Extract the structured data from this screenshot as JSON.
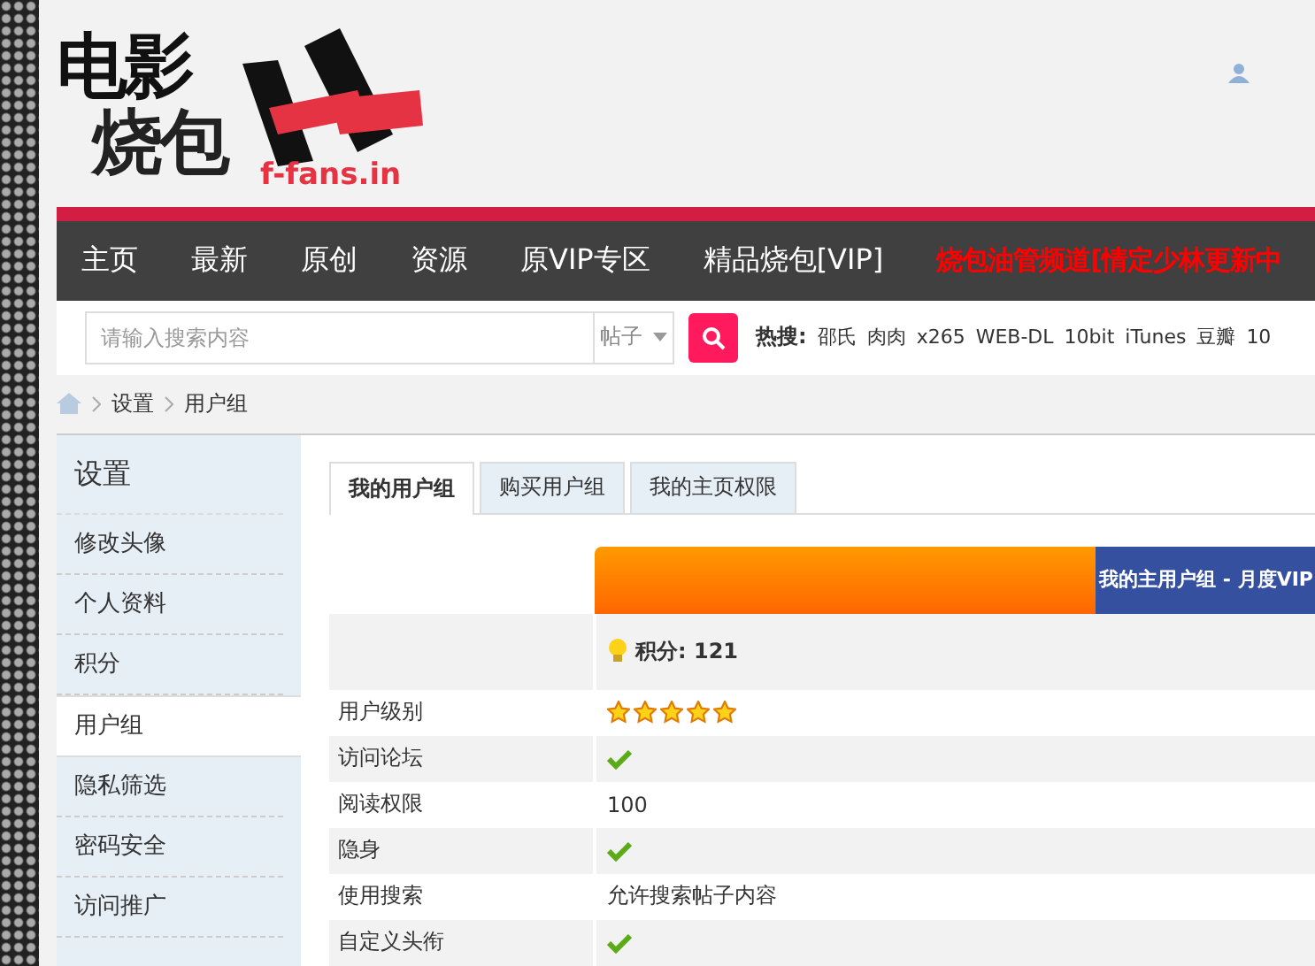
{
  "logo": {
    "line_1": "电影",
    "line_2": "烧包",
    "domain": "f-fans.in"
  },
  "nav": [
    {
      "label": "主页",
      "kind": "normal"
    },
    {
      "label": "最新",
      "kind": "normal"
    },
    {
      "label": "原创",
      "kind": "normal"
    },
    {
      "label": "资源",
      "kind": "normal"
    },
    {
      "label": "原VIP专区",
      "kind": "normal"
    },
    {
      "label": "精品烧包[VIP]",
      "kind": "normal"
    },
    {
      "label": "烧包油管频道[情定少林更新中",
      "kind": "highlight"
    }
  ],
  "search": {
    "placeholder": "请输入搜索内容",
    "scope": "帖子",
    "hot_label": "热搜:",
    "hot": [
      "邵氏",
      "肉肉",
      "x265",
      "WEB-DL",
      "10bit",
      "iTunes",
      "豆瓣",
      "10"
    ]
  },
  "breadcrumb": [
    "设置",
    "用户组"
  ],
  "sidebar": {
    "title": "设置",
    "items": [
      {
        "label": "修改头像",
        "selected": false
      },
      {
        "label": "个人资料",
        "selected": false
      },
      {
        "label": "积分",
        "selected": false
      },
      {
        "label": "用户组",
        "selected": true
      },
      {
        "label": "隐私筛选",
        "selected": false
      },
      {
        "label": "密码安全",
        "selected": false
      },
      {
        "label": "访问推广",
        "selected": false
      }
    ]
  },
  "tabs": [
    {
      "label": "我的用户组",
      "selected": true
    },
    {
      "label": "购买用户组",
      "selected": false
    },
    {
      "label": "我的主页权限",
      "selected": false
    }
  ],
  "group_header": "我的主用户组 - 月度VIP",
  "points": "积分: 121",
  "rows": [
    {
      "label": "用户级别",
      "kind": "stars",
      "stars": 5
    },
    {
      "label": "访问论坛",
      "kind": "check"
    },
    {
      "label": "阅读权限",
      "kind": "text",
      "value": "100"
    },
    {
      "label": "隐身",
      "kind": "check"
    },
    {
      "label": "使用搜索",
      "kind": "text",
      "value": "允许搜索帖子内容"
    },
    {
      "label": "自定义头衔",
      "kind": "check"
    }
  ]
}
